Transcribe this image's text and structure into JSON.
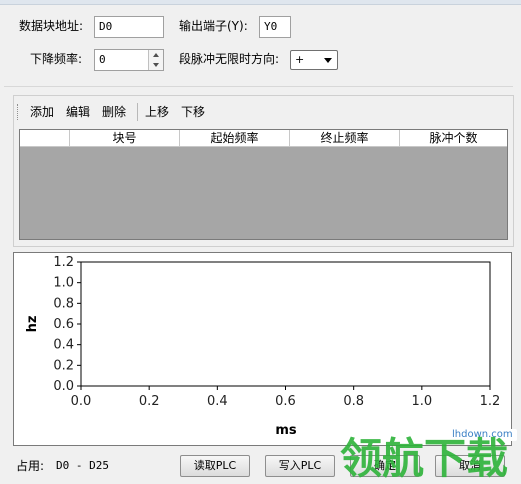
{
  "form": {
    "block_address_label": "数据块地址:",
    "block_address_value": "D0",
    "output_terminal_label": "输出端子(Y):",
    "output_terminal_value": "Y0",
    "decel_freq_label": "下降频率:",
    "decel_freq_value": "0",
    "infinite_dir_label": "段脉冲无限时方向:",
    "infinite_dir_value": "+"
  },
  "toolbar": {
    "add": "添加",
    "edit": "编辑",
    "delete": "删除",
    "move_up": "上移",
    "move_down": "下移"
  },
  "table": {
    "columns": [
      "块号",
      "起始频率",
      "终止频率",
      "脉冲个数"
    ],
    "rows": []
  },
  "chart_data": {
    "type": "line",
    "series": [],
    "xlabel": "ms",
    "ylabel": "hz",
    "xlim": [
      0.0,
      1.2
    ],
    "ylim": [
      0.0,
      1.2
    ],
    "xticks": [
      "0.0",
      "0.2",
      "0.4",
      "0.6",
      "0.8",
      "1.0",
      "1.2"
    ],
    "yticks": [
      "0.0",
      "0.2",
      "0.4",
      "0.6",
      "0.8",
      "1.0",
      "1.2"
    ],
    "grid": false
  },
  "footer": {
    "occupy_label": "占用:",
    "occupy_value": "D0 - D25",
    "read_plc": "读取PLC",
    "write_plc": "写入PLC",
    "ok": "确定",
    "cancel": "取消"
  },
  "watermark": {
    "text": "领航下载",
    "url": "lhdown.com"
  }
}
